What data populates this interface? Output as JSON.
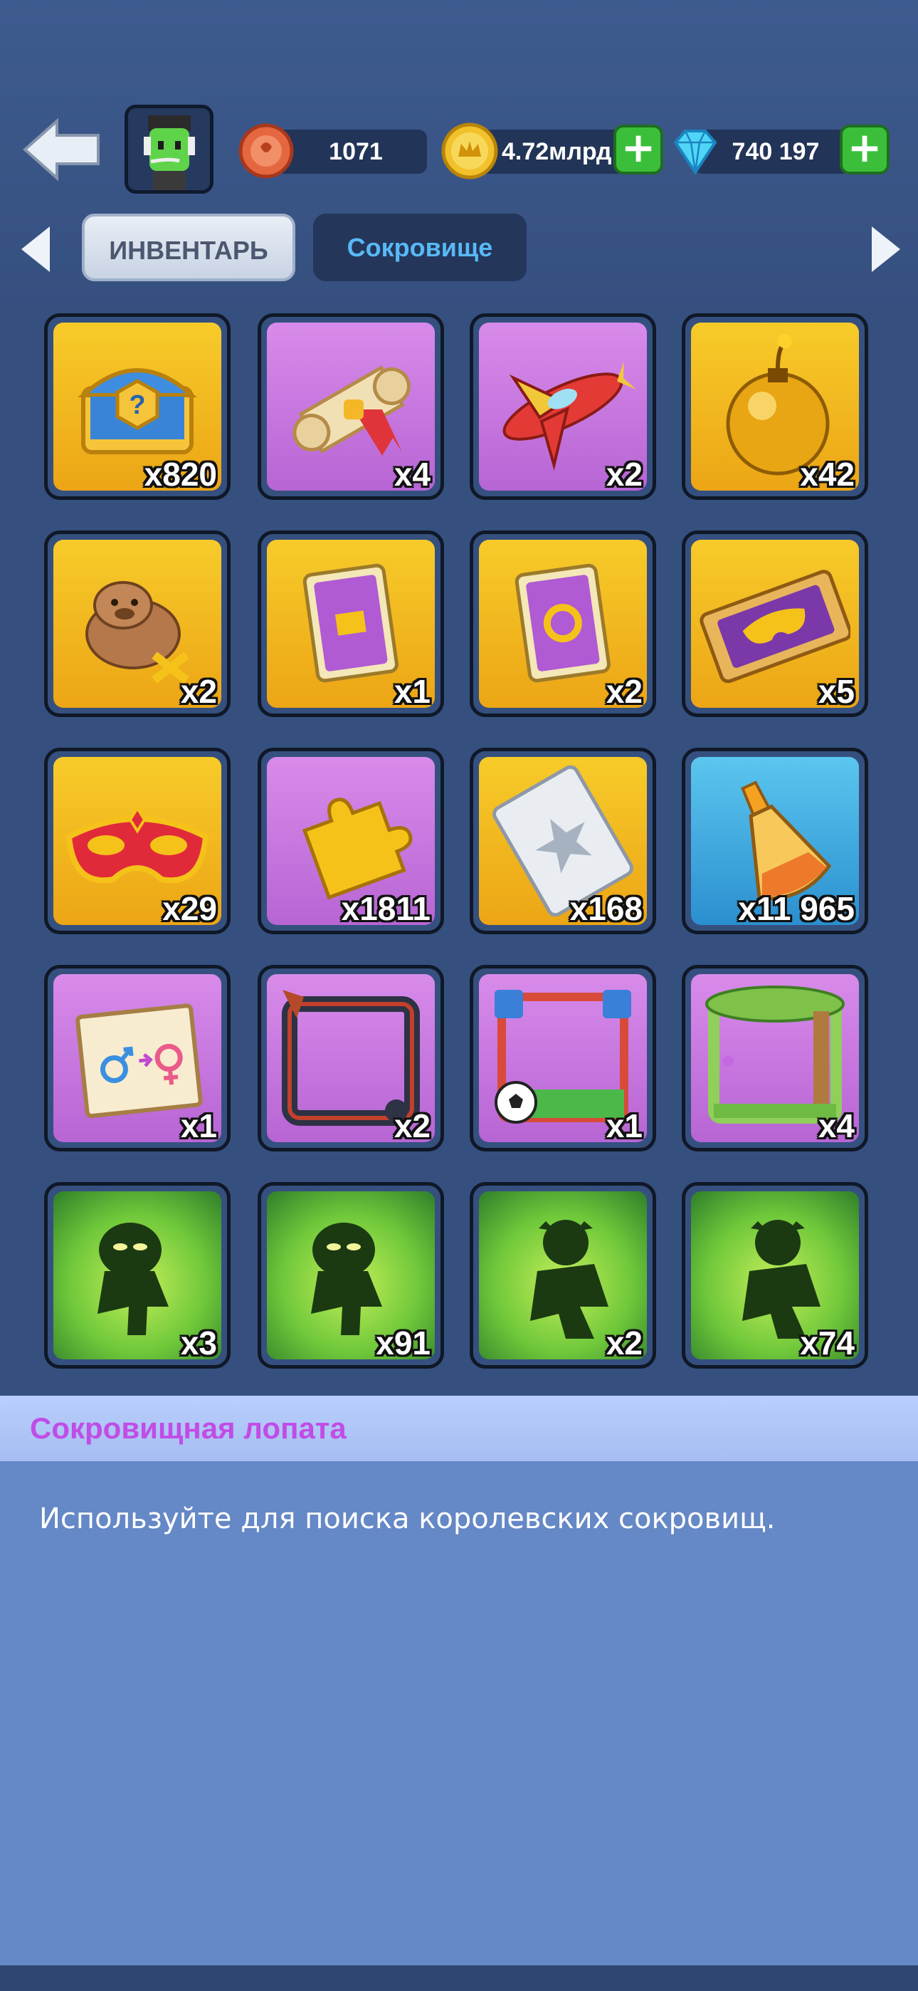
{
  "header": {
    "tickets": "1071",
    "gold": "4.72млрд",
    "gems": "740 197"
  },
  "tabs": [
    {
      "label": "ИНВЕНТАРЬ"
    },
    {
      "label": "Сокровище"
    }
  ],
  "items": [
    {
      "name": "mystery-chest",
      "count": "x820",
      "bg": "gold"
    },
    {
      "name": "scroll",
      "count": "x4",
      "bg": "purple"
    },
    {
      "name": "airplane",
      "count": "x2",
      "bg": "purple"
    },
    {
      "name": "bomb",
      "count": "x42",
      "bg": "gold"
    },
    {
      "name": "capybara-swap",
      "count": "x2",
      "bg": "gold"
    },
    {
      "name": "card-box",
      "count": "x1",
      "bg": "gold"
    },
    {
      "name": "card-refresh",
      "count": "x2",
      "bg": "gold"
    },
    {
      "name": "mask-ticket",
      "count": "x5",
      "bg": "gold"
    },
    {
      "name": "red-mask",
      "count": "x29",
      "bg": "gold"
    },
    {
      "name": "puzzle-piece",
      "count": "x1811",
      "bg": "purple"
    },
    {
      "name": "silver-ticket",
      "count": "x168",
      "bg": "gold"
    },
    {
      "name": "potion",
      "count": "x11 965",
      "bg": "blue"
    },
    {
      "name": "gender-card",
      "count": "x1",
      "bg": "purple"
    },
    {
      "name": "frame-dark",
      "count": "x2",
      "bg": "purple"
    },
    {
      "name": "frame-soccer",
      "count": "x1",
      "bg": "purple"
    },
    {
      "name": "frame-forest",
      "count": "x4",
      "bg": "purple"
    },
    {
      "name": "runner-shadow",
      "count": "x3",
      "bg": "green"
    },
    {
      "name": "runner-shadow",
      "count": "x91",
      "bg": "green"
    },
    {
      "name": "jumper-shadow",
      "count": "x2",
      "bg": "green"
    },
    {
      "name": "jumper-shadow",
      "count": "x74",
      "bg": "green"
    }
  ],
  "description": {
    "title": "Сокровищная лопата",
    "text": "Используйте для поиска королевских сокровищ."
  }
}
